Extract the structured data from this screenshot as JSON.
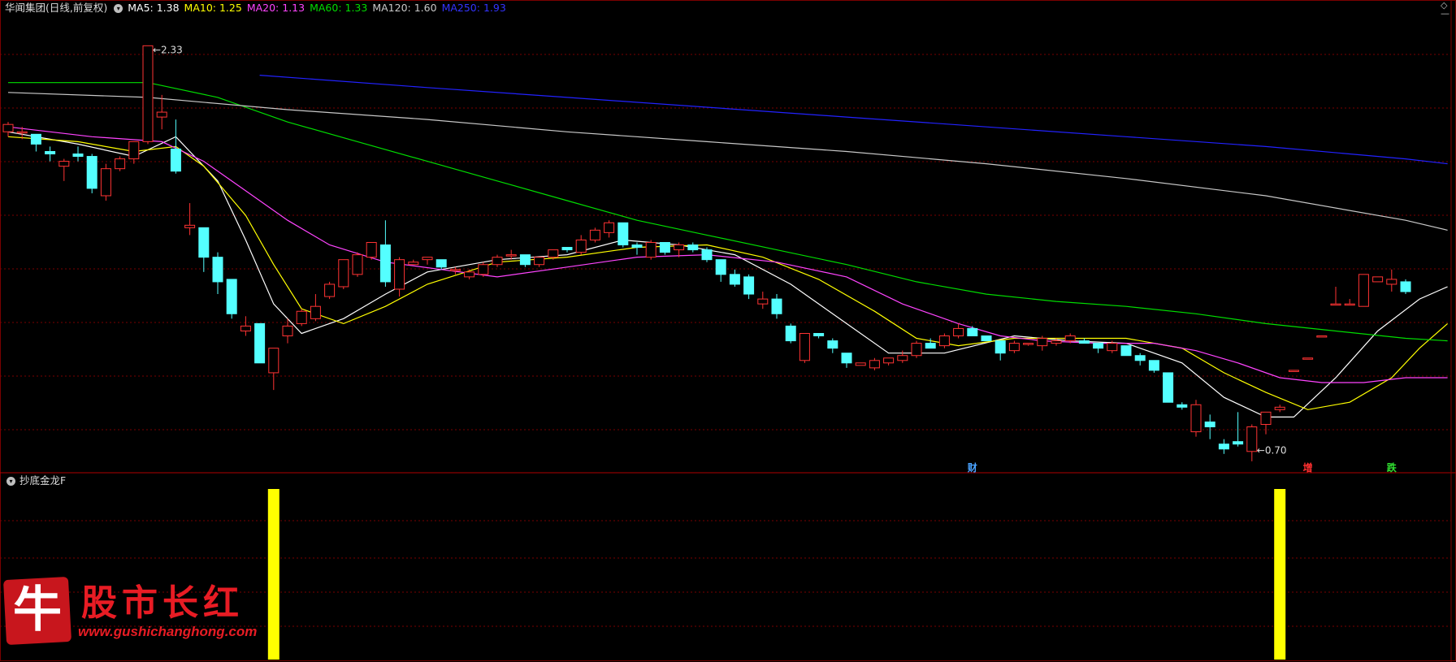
{
  "header": {
    "title": "华闻集团(日线,前复权)",
    "ma_labels": [
      {
        "text": "MA5: 1.38",
        "color": "#ffffff"
      },
      {
        "text": "MA10: 1.25",
        "color": "#ffff00"
      },
      {
        "text": "MA20: 1.13",
        "color": "#ff44ff"
      },
      {
        "text": "MA60: 1.33",
        "color": "#00dd00"
      },
      {
        "text": "MA120: 1.60",
        "color": "#c8c8c8"
      },
      {
        "text": "MA250: 1.93",
        "color": "#3333ff"
      }
    ]
  },
  "indicator": {
    "title": "抄底金龙F"
  },
  "markers": [
    {
      "text": "财",
      "color": "#4aa3ff"
    },
    {
      "text": "增",
      "color": "#ff3030"
    },
    {
      "text": "跌",
      "color": "#30e030"
    }
  ],
  "logo": {
    "text": "股市长红",
    "url": "www.gushichanghong.com",
    "badge": "牛"
  },
  "colors": {
    "up": "#ff3333",
    "down": "#54ffff",
    "grid": "#7a0000",
    "signal": "#ffff00"
  },
  "chart_data": {
    "type": "candlestick",
    "price_range": [
      0.6,
      2.45
    ],
    "annotations": [
      {
        "text": "2.33",
        "index": 10,
        "value": 2.33
      },
      {
        "text": "0.70",
        "index": 89,
        "value": 0.7
      }
    ],
    "candles": [
      [
        1.98,
        2.02,
        1.96,
        2.01
      ],
      [
        1.98,
        2.0,
        1.95,
        1.98
      ],
      [
        1.97,
        1.97,
        1.9,
        1.93
      ],
      [
        1.9,
        1.92,
        1.86,
        1.89
      ],
      [
        1.84,
        1.87,
        1.78,
        1.86
      ],
      [
        1.89,
        1.92,
        1.86,
        1.88
      ],
      [
        1.88,
        1.89,
        1.73,
        1.75
      ],
      [
        1.72,
        1.85,
        1.7,
        1.83
      ],
      [
        1.83,
        1.88,
        1.82,
        1.87
      ],
      [
        1.87,
        1.94,
        1.85,
        1.94
      ],
      [
        1.94,
        2.33,
        1.93,
        2.33
      ],
      [
        2.04,
        2.13,
        1.99,
        2.06
      ],
      [
        1.91,
        2.03,
        1.81,
        1.82
      ],
      [
        1.59,
        1.69,
        1.56,
        1.6
      ],
      [
        1.59,
        1.59,
        1.41,
        1.47
      ],
      [
        1.47,
        1.49,
        1.32,
        1.37
      ],
      [
        1.38,
        1.38,
        1.22,
        1.24
      ],
      [
        1.17,
        1.23,
        1.15,
        1.19
      ],
      [
        1.2,
        1.2,
        1.04,
        1.04
      ],
      [
        1.0,
        1.1,
        0.93,
        1.1
      ],
      [
        1.15,
        1.22,
        1.12,
        1.19
      ],
      [
        1.2,
        1.26,
        1.19,
        1.25
      ],
      [
        1.22,
        1.32,
        1.21,
        1.27
      ],
      [
        1.31,
        1.37,
        1.3,
        1.36
      ],
      [
        1.35,
        1.46,
        1.34,
        1.46
      ],
      [
        1.4,
        1.49,
        1.39,
        1.48
      ],
      [
        1.47,
        1.53,
        1.46,
        1.53
      ],
      [
        1.52,
        1.62,
        1.35,
        1.37
      ],
      [
        1.34,
        1.47,
        1.31,
        1.46
      ],
      [
        1.44,
        1.46,
        1.44,
        1.45
      ],
      [
        1.46,
        1.47,
        1.44,
        1.47
      ],
      [
        1.46,
        1.46,
        1.42,
        1.43
      ],
      [
        1.42,
        1.43,
        1.4,
        1.42
      ],
      [
        1.39,
        1.42,
        1.38,
        1.41
      ],
      [
        1.4,
        1.45,
        1.39,
        1.44
      ],
      [
        1.44,
        1.48,
        1.43,
        1.47
      ],
      [
        1.48,
        1.5,
        1.46,
        1.48
      ],
      [
        1.48,
        1.48,
        1.43,
        1.44
      ],
      [
        1.44,
        1.47,
        1.43,
        1.47
      ],
      [
        1.47,
        1.5,
        1.46,
        1.5
      ],
      [
        1.51,
        1.51,
        1.49,
        1.5
      ],
      [
        1.49,
        1.56,
        1.48,
        1.54
      ],
      [
        1.54,
        1.59,
        1.53,
        1.58
      ],
      [
        1.57,
        1.62,
        1.55,
        1.61
      ],
      [
        1.61,
        1.61,
        1.51,
        1.52
      ],
      [
        1.52,
        1.53,
        1.48,
        1.51
      ],
      [
        1.47,
        1.54,
        1.46,
        1.53
      ],
      [
        1.53,
        1.53,
        1.48,
        1.49
      ],
      [
        1.5,
        1.53,
        1.47,
        1.52
      ],
      [
        1.52,
        1.53,
        1.49,
        1.5
      ],
      [
        1.5,
        1.51,
        1.45,
        1.46
      ],
      [
        1.46,
        1.46,
        1.37,
        1.4
      ],
      [
        1.4,
        1.42,
        1.35,
        1.36
      ],
      [
        1.39,
        1.4,
        1.3,
        1.32
      ],
      [
        1.28,
        1.33,
        1.26,
        1.3
      ],
      [
        1.3,
        1.32,
        1.22,
        1.24
      ],
      [
        1.19,
        1.2,
        1.12,
        1.13
      ],
      [
        1.05,
        1.16,
        1.04,
        1.16
      ],
      [
        1.16,
        1.16,
        1.14,
        1.15
      ],
      [
        1.13,
        1.14,
        1.08,
        1.1
      ],
      [
        1.08,
        1.08,
        1.02,
        1.04
      ],
      [
        1.03,
        1.04,
        1.03,
        1.04
      ],
      [
        1.02,
        1.06,
        1.01,
        1.05
      ],
      [
        1.04,
        1.06,
        1.03,
        1.06
      ],
      [
        1.05,
        1.09,
        1.04,
        1.07
      ],
      [
        1.07,
        1.13,
        1.06,
        1.12
      ],
      [
        1.12,
        1.14,
        1.1,
        1.1
      ],
      [
        1.11,
        1.16,
        1.1,
        1.15
      ],
      [
        1.15,
        1.2,
        1.14,
        1.18
      ],
      [
        1.18,
        1.19,
        1.15,
        1.15
      ],
      [
        1.15,
        1.15,
        1.13,
        1.13
      ],
      [
        1.13,
        1.13,
        1.05,
        1.08
      ],
      [
        1.09,
        1.13,
        1.08,
        1.12
      ],
      [
        1.12,
        1.12,
        1.11,
        1.12
      ],
      [
        1.11,
        1.15,
        1.09,
        1.14
      ],
      [
        1.12,
        1.14,
        1.11,
        1.13
      ],
      [
        1.13,
        1.16,
        1.12,
        1.15
      ],
      [
        1.13,
        1.14,
        1.12,
        1.12
      ],
      [
        1.12,
        1.12,
        1.08,
        1.1
      ],
      [
        1.09,
        1.13,
        1.08,
        1.12
      ],
      [
        1.11,
        1.11,
        1.07,
        1.07
      ],
      [
        1.07,
        1.08,
        1.03,
        1.05
      ],
      [
        1.05,
        1.05,
        1.0,
        1.01
      ],
      [
        1.0,
        1.0,
        0.88,
        0.88
      ],
      [
        0.87,
        0.88,
        0.85,
        0.86
      ],
      [
        0.76,
        0.89,
        0.74,
        0.87
      ],
      [
        0.8,
        0.83,
        0.73,
        0.78
      ],
      [
        0.71,
        0.73,
        0.67,
        0.69
      ],
      [
        0.72,
        0.84,
        0.7,
        0.71
      ],
      [
        0.68,
        0.79,
        0.64,
        0.78
      ],
      [
        0.79,
        0.84,
        0.75,
        0.84
      ],
      [
        0.85,
        0.87,
        0.84,
        0.86
      ],
      [
        1.01,
        1.01,
        1.01,
        1.01
      ],
      [
        1.06,
        1.06,
        1.06,
        1.06
      ],
      [
        1.15,
        1.15,
        1.15,
        1.15
      ],
      [
        1.28,
        1.35,
        1.28,
        1.28
      ],
      [
        1.28,
        1.3,
        1.28,
        1.28
      ],
      [
        1.27,
        1.4,
        1.27,
        1.4
      ],
      [
        1.37,
        1.39,
        1.37,
        1.39
      ],
      [
        1.36,
        1.42,
        1.33,
        1.38
      ],
      [
        1.37,
        1.38,
        1.32,
        1.33
      ]
    ],
    "ma": [
      {
        "name": "MA5",
        "color": "#ffffff",
        "points": [
          [
            0,
            1.98
          ],
          [
            5,
            1.93
          ],
          [
            9,
            1.88
          ],
          [
            12,
            1.96
          ],
          [
            15,
            1.78
          ],
          [
            17,
            1.54
          ],
          [
            19,
            1.28
          ],
          [
            21,
            1.16
          ],
          [
            24,
            1.22
          ],
          [
            27,
            1.32
          ],
          [
            30,
            1.41
          ],
          [
            35,
            1.46
          ],
          [
            40,
            1.48
          ],
          [
            44,
            1.54
          ],
          [
            48,
            1.52
          ],
          [
            52,
            1.48
          ],
          [
            56,
            1.36
          ],
          [
            60,
            1.2
          ],
          [
            63,
            1.08
          ],
          [
            67,
            1.08
          ],
          [
            72,
            1.15
          ],
          [
            76,
            1.13
          ],
          [
            80,
            1.12
          ],
          [
            84,
            1.04
          ],
          [
            87,
            0.9
          ],
          [
            90,
            0.82
          ],
          [
            92,
            0.82
          ],
          [
            95,
            0.98
          ],
          [
            98,
            1.17
          ],
          [
            101,
            1.3
          ],
          [
            103,
            1.35
          ]
        ]
      },
      {
        "name": "MA10",
        "color": "#ffff00",
        "points": [
          [
            0,
            1.96
          ],
          [
            5,
            1.94
          ],
          [
            9,
            1.9
          ],
          [
            12,
            1.92
          ],
          [
            14,
            1.84
          ],
          [
            17,
            1.64
          ],
          [
            19,
            1.44
          ],
          [
            21,
            1.26
          ],
          [
            24,
            1.2
          ],
          [
            27,
            1.27
          ],
          [
            30,
            1.36
          ],
          [
            35,
            1.45
          ],
          [
            40,
            1.47
          ],
          [
            45,
            1.51
          ],
          [
            50,
            1.52
          ],
          [
            54,
            1.47
          ],
          [
            58,
            1.38
          ],
          [
            62,
            1.25
          ],
          [
            65,
            1.14
          ],
          [
            68,
            1.11
          ],
          [
            72,
            1.14
          ],
          [
            76,
            1.14
          ],
          [
            80,
            1.14
          ],
          [
            84,
            1.1
          ],
          [
            87,
            1.0
          ],
          [
            90,
            0.92
          ],
          [
            93,
            0.85
          ],
          [
            96,
            0.88
          ],
          [
            99,
            0.98
          ],
          [
            101,
            1.1
          ],
          [
            103,
            1.2
          ]
        ]
      },
      {
        "name": "MA20",
        "color": "#ff44ff",
        "points": [
          [
            0,
            2.0
          ],
          [
            6,
            1.96
          ],
          [
            11,
            1.94
          ],
          [
            14,
            1.86
          ],
          [
            17,
            1.74
          ],
          [
            20,
            1.62
          ],
          [
            23,
            1.52
          ],
          [
            27,
            1.45
          ],
          [
            31,
            1.42
          ],
          [
            35,
            1.39
          ],
          [
            40,
            1.43
          ],
          [
            45,
            1.47
          ],
          [
            50,
            1.48
          ],
          [
            55,
            1.45
          ],
          [
            60,
            1.39
          ],
          [
            64,
            1.28
          ],
          [
            68,
            1.2
          ],
          [
            71,
            1.15
          ],
          [
            74,
            1.13
          ],
          [
            78,
            1.12
          ],
          [
            82,
            1.12
          ],
          [
            85,
            1.09
          ],
          [
            88,
            1.04
          ],
          [
            91,
            0.98
          ],
          [
            94,
            0.96
          ],
          [
            97,
            0.96
          ],
          [
            100,
            0.98
          ],
          [
            103,
            0.98
          ]
        ]
      },
      {
        "name": "MA60",
        "color": "#00dd00",
        "points": [
          [
            0,
            2.18
          ],
          [
            10,
            2.18
          ],
          [
            15,
            2.12
          ],
          [
            20,
            2.02
          ],
          [
            25,
            1.94
          ],
          [
            30,
            1.86
          ],
          [
            35,
            1.78
          ],
          [
            40,
            1.7
          ],
          [
            45,
            1.62
          ],
          [
            50,
            1.56
          ],
          [
            55,
            1.5
          ],
          [
            60,
            1.44
          ],
          [
            65,
            1.37
          ],
          [
            70,
            1.32
          ],
          [
            75,
            1.29
          ],
          [
            80,
            1.27
          ],
          [
            85,
            1.24
          ],
          [
            90,
            1.2
          ],
          [
            95,
            1.17
          ],
          [
            100,
            1.14
          ],
          [
            103,
            1.13
          ]
        ]
      },
      {
        "name": "MA120",
        "color": "#c8c8c8",
        "points": [
          [
            0,
            2.14
          ],
          [
            10,
            2.12
          ],
          [
            20,
            2.07
          ],
          [
            30,
            2.03
          ],
          [
            40,
            1.98
          ],
          [
            50,
            1.94
          ],
          [
            60,
            1.9
          ],
          [
            70,
            1.85
          ],
          [
            80,
            1.79
          ],
          [
            90,
            1.72
          ],
          [
            100,
            1.62
          ],
          [
            103,
            1.58
          ]
        ]
      },
      {
        "name": "MA250",
        "color": "#2222ff",
        "points": [
          [
            18,
            2.21
          ],
          [
            30,
            2.16
          ],
          [
            40,
            2.12
          ],
          [
            50,
            2.08
          ],
          [
            60,
            2.04
          ],
          [
            70,
            2.0
          ],
          [
            80,
            1.96
          ],
          [
            90,
            1.92
          ],
          [
            100,
            1.87
          ],
          [
            103,
            1.85
          ]
        ]
      }
    ],
    "signals": [
      {
        "index": 19
      },
      {
        "index": 91
      }
    ],
    "marker_indices": [
      69,
      93,
      99
    ]
  }
}
